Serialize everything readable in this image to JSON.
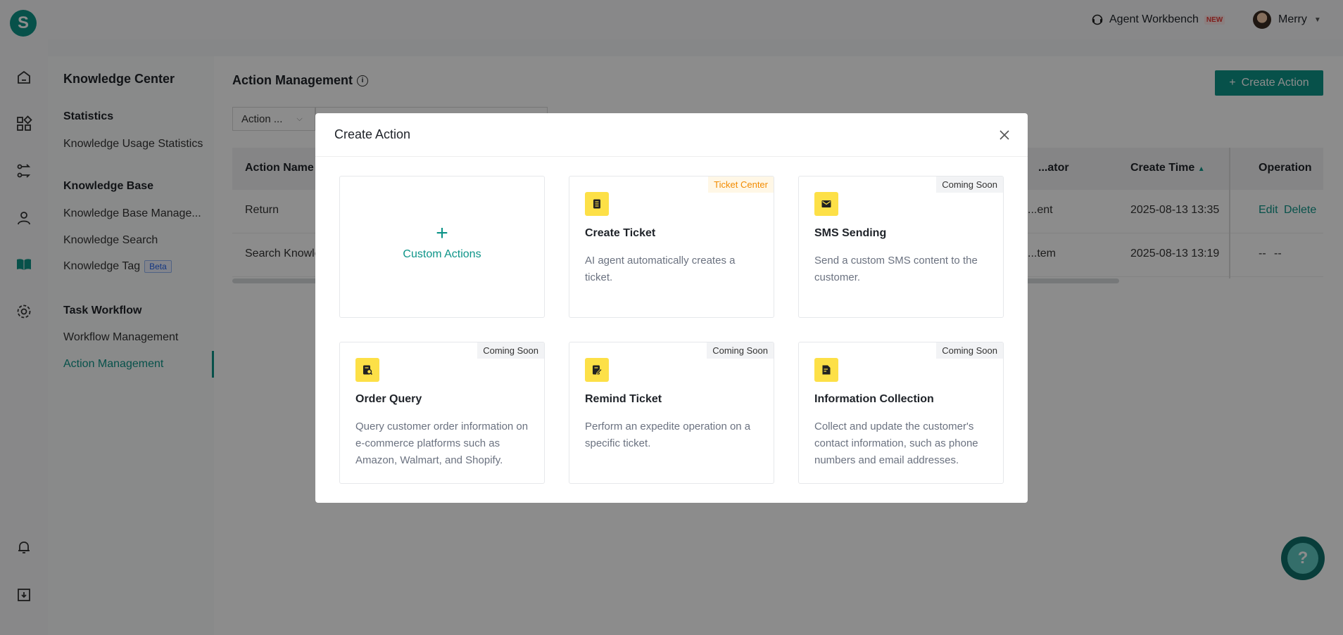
{
  "brand": {
    "logo_letter": "S"
  },
  "header": {
    "workbench_label": "Agent Workbench",
    "new_badge": "NEW",
    "user_name": "Merry"
  },
  "rail": {
    "icons": [
      "home-icon",
      "apps-icon",
      "flow-icon",
      "agent-icon",
      "knowledge-book-icon",
      "settings-icon",
      "bell-icon",
      "download-icon"
    ]
  },
  "subnav": {
    "title": "Knowledge Center",
    "groups": [
      {
        "label": "Statistics",
        "items": [
          "Knowledge Usage Statistics"
        ]
      },
      {
        "label": "Knowledge Base",
        "items": [
          "Knowledge Base Manage...",
          "Knowledge Search",
          "Knowledge Tag"
        ]
      },
      {
        "label": "Task Workflow",
        "items": [
          "Workflow Management",
          "Action Management"
        ]
      }
    ],
    "beta_badge": "Beta",
    "active_item": "Action Management"
  },
  "main": {
    "title": "Action Management",
    "create_button": "Create Action",
    "filter_select": "Action ...",
    "table": {
      "headers": [
        "Action Name",
        "...ator",
        "Create Time",
        "Operation"
      ],
      "rows": [
        {
          "name": "Return",
          "creator": "...ent",
          "create_time": "2025-08-13 13:35",
          "op_edit": "Edit",
          "op_delete": "Delete"
        },
        {
          "name": "Search Knowle",
          "creator": "...tem",
          "create_time": "2025-08-13 13:19",
          "op_edit": "--",
          "op_delete": "--"
        }
      ]
    }
  },
  "modal": {
    "title": "Create Action",
    "custom_card": {
      "plus": "+",
      "label": "Custom Actions"
    },
    "cards": [
      {
        "icon": "document-list-icon",
        "tag": "Ticket Center",
        "title": "Create Ticket",
        "desc": "AI agent automatically creates a ticket."
      },
      {
        "icon": "envelope-icon",
        "tag": "Coming Soon",
        "title": "SMS Sending",
        "desc": "Send a custom SMS content to the customer."
      },
      {
        "icon": "order-search-icon",
        "tag": "Coming Soon",
        "title": "Order Query",
        "desc": "Query customer order information on e-commerce platforms such as Amazon, Walmart, and Shopify."
      },
      {
        "icon": "edit-document-icon",
        "tag": "Coming Soon",
        "title": "Remind Ticket",
        "desc": "Perform an expedite operation on a specific ticket."
      },
      {
        "icon": "form-edit-icon",
        "tag": "Coming Soon",
        "title": "Information Collection",
        "desc": "Collect and update the customer's contact information, such as phone numbers and email addresses."
      }
    ]
  },
  "help": {
    "label": "?"
  },
  "colors": {
    "accent": "#0d9488",
    "icon_bg": "#fde047",
    "tag_orange": "#f28b00"
  }
}
